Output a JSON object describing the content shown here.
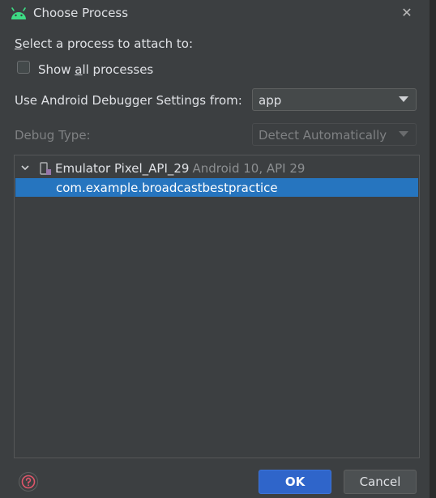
{
  "window": {
    "title": "Choose Process",
    "close_glyph": "✕",
    "app_icon": "android-icon"
  },
  "form": {
    "select_prefix": "S",
    "select_rest": "elect a process to attach to:",
    "show_all_pre": "Show ",
    "show_all_u": "a",
    "show_all_post": "ll processes",
    "show_all_checked": false,
    "debugger_settings_label": "Use Android Debugger Settings from:",
    "debugger_settings_value": "app",
    "debug_type_label": "Debug Type:",
    "debug_type_value": "Detect Automatically"
  },
  "tree": {
    "device_name": "Emulator Pixel_API_29",
    "device_info": "Android 10, API 29",
    "processes": [
      "com.example.broadcastbestpractice"
    ]
  },
  "buttons": {
    "ok": "OK",
    "cancel": "Cancel"
  },
  "colors": {
    "accent": "#2f65ca",
    "selection": "#2675bf",
    "android_green": "#3ddc84",
    "help_red": "#e0566a"
  }
}
